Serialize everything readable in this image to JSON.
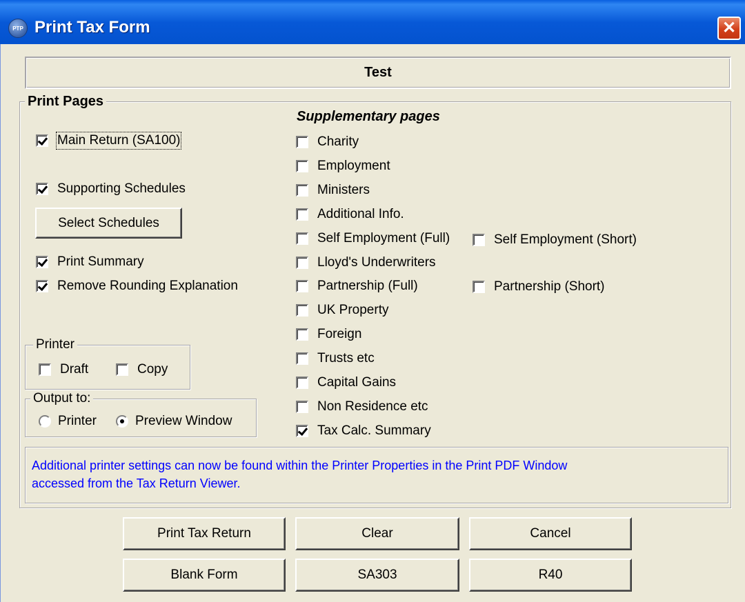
{
  "window": {
    "icon_text": "PTP",
    "title": "Print Tax Form",
    "close_glyph": "✕"
  },
  "client_name": "Test",
  "print_pages": {
    "legend": "Print Pages",
    "main_return": {
      "label": "Main Return (SA100)",
      "checked": true
    },
    "supporting_schedules": {
      "label": "Supporting Schedules",
      "checked": true
    },
    "select_schedules_button": "Select Schedules",
    "print_summary": {
      "label": "Print Summary",
      "checked": true
    },
    "remove_rounding": {
      "label": "Remove Rounding Explanation",
      "checked": true
    }
  },
  "printer": {
    "legend": "Printer",
    "draft": {
      "label": "Draft",
      "checked": false
    },
    "copy": {
      "label": "Copy",
      "checked": false
    }
  },
  "output_to": {
    "legend": "Output to:",
    "options": [
      {
        "label": "Printer",
        "selected": false
      },
      {
        "label": "Preview Window",
        "selected": true
      }
    ]
  },
  "supplementary": {
    "heading": "Supplementary pages",
    "items": [
      {
        "label": "Charity",
        "checked": false
      },
      {
        "label": "Employment",
        "checked": false
      },
      {
        "label": "Ministers",
        "checked": false
      },
      {
        "label": "Additional Info.",
        "checked": false
      },
      {
        "label": "Self Employment (Full)",
        "checked": false
      },
      {
        "label": "Lloyd's Underwriters",
        "checked": false
      },
      {
        "label": "Partnership (Full)",
        "checked": false
      },
      {
        "label": "UK Property",
        "checked": false
      },
      {
        "label": "Foreign",
        "checked": false
      },
      {
        "label": "Trusts etc",
        "checked": false
      },
      {
        "label": "Capital Gains",
        "checked": false
      },
      {
        "label": "Non Residence etc",
        "checked": false
      },
      {
        "label": "Tax Calc. Summary",
        "checked": true
      }
    ],
    "self_employment_short": {
      "label": "Self Employment (Short)",
      "checked": false
    },
    "partnership_short": {
      "label": "Partnership (Short)",
      "checked": false
    }
  },
  "info": {
    "line1": "Additional printer settings can now be found within the Printer Properties in the Print PDF Window",
    "line2": "accessed from the Tax Return Viewer.",
    "color": "#0000ff"
  },
  "buttons": {
    "print_tax_return": "Print Tax Return",
    "clear": "Clear",
    "cancel": "Cancel",
    "blank_form": "Blank Form",
    "sa303": "SA303",
    "r40": "R40"
  }
}
